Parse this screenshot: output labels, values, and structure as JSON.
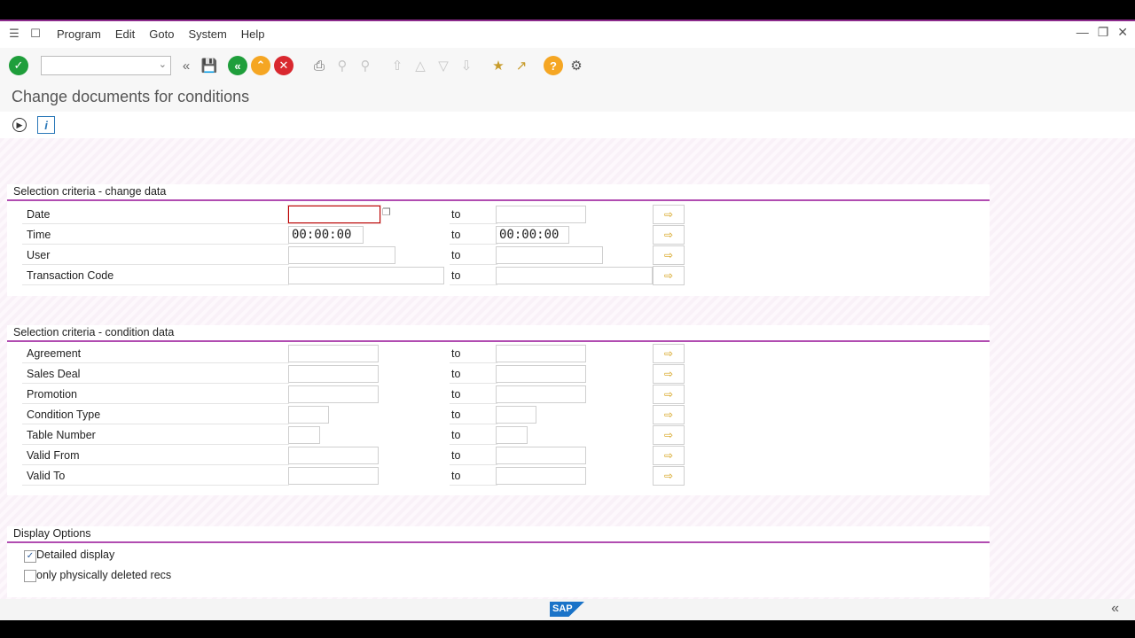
{
  "menubar": {
    "items": [
      "Program",
      "Edit",
      "Goto",
      "System",
      "Help"
    ]
  },
  "toolbar": {
    "command_value": ""
  },
  "page": {
    "title": "Change documents for conditions"
  },
  "section_change": {
    "heading": "Selection criteria - change data",
    "to_label": "to",
    "rows": [
      {
        "label": "Date",
        "from": "",
        "to": ""
      },
      {
        "label": "Time",
        "from": "00:00:00",
        "to": "00:00:00"
      },
      {
        "label": "User",
        "from": "",
        "to": ""
      },
      {
        "label": "Transaction Code",
        "from": "",
        "to": ""
      }
    ]
  },
  "section_condition": {
    "heading": "Selection criteria - condition data",
    "to_label": "to",
    "rows": [
      {
        "label": "Agreement",
        "from": "",
        "to": ""
      },
      {
        "label": "Sales Deal",
        "from": "",
        "to": ""
      },
      {
        "label": "Promotion",
        "from": "",
        "to": ""
      },
      {
        "label": "Condition Type",
        "from": "",
        "to": ""
      },
      {
        "label": "Table Number",
        "from": "",
        "to": ""
      },
      {
        "label": "Valid From",
        "from": "",
        "to": ""
      },
      {
        "label": "Valid To",
        "from": "",
        "to": ""
      }
    ]
  },
  "section_display": {
    "heading": "Display Options",
    "options": [
      {
        "label": "Detailed display",
        "checked": true
      },
      {
        "label": "only physically deleted recs",
        "checked": false
      }
    ]
  },
  "statusbar": {
    "logo": "SAP"
  },
  "colors": {
    "accent": "#b14cb1",
    "enter_green": "#1f9e3b",
    "back_green": "#1f9e3b",
    "exit_orange": "#f5a623",
    "cancel_red": "#d9282f",
    "help_orange": "#f5a623"
  }
}
